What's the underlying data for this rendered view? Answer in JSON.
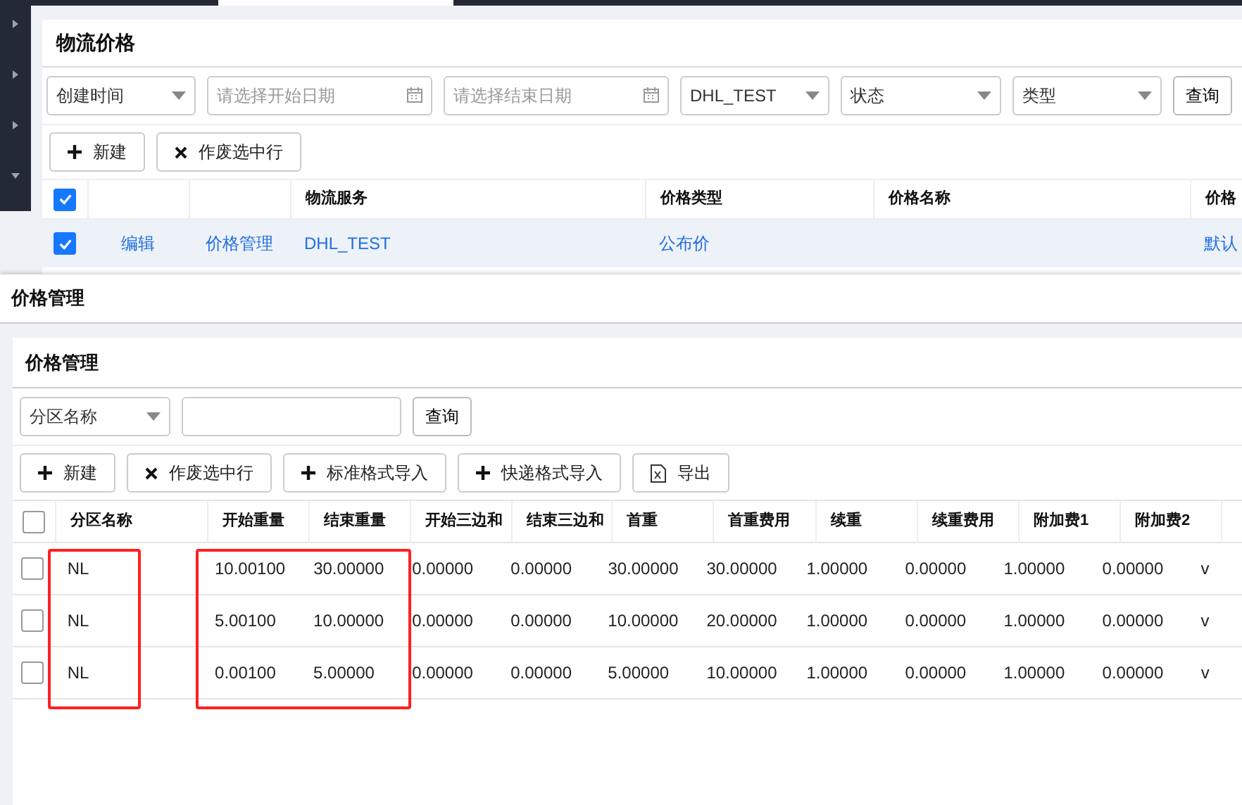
{
  "sidebar": {
    "items": [
      {
        "expanded": false
      },
      {
        "expanded": false
      },
      {
        "expanded": false
      },
      {
        "expanded": true
      }
    ]
  },
  "main": {
    "title": "物流价格",
    "filters": [
      {
        "kind": "select",
        "value": "创建时间"
      },
      {
        "kind": "date",
        "placeholder": "请选择开始日期"
      },
      {
        "kind": "date",
        "placeholder": "请选择结束日期"
      },
      {
        "kind": "select",
        "value": "DHL_TEST"
      },
      {
        "kind": "select",
        "value": "状态"
      },
      {
        "kind": "select",
        "value": "类型"
      }
    ],
    "search_button": "查询",
    "buttons": [
      {
        "kind": "plus",
        "label": "新建"
      },
      {
        "kind": "x",
        "label": "作废选中行"
      }
    ],
    "table": {
      "header_checked": true,
      "columns": [
        "物流服务",
        "价格类型",
        "价格名称",
        "价格"
      ],
      "rows": [
        {
          "checked": true,
          "edit_link": "编辑",
          "manage_link": "价格管理",
          "service": "DHL_TEST",
          "price_type": "公布价",
          "price_level": "默认"
        }
      ]
    }
  },
  "dialog": {
    "title": "价格管理",
    "panel": {
      "title": "价格管理",
      "select": "分区名称",
      "search_button": "查询",
      "buttons": [
        {
          "kind": "plus",
          "label": "新建"
        },
        {
          "kind": "x",
          "label": "作废选中行"
        },
        {
          "kind": "plus",
          "label": "标准格式导入"
        },
        {
          "kind": "plus",
          "label": "快递格式导入"
        },
        {
          "kind": "export",
          "label": "导出"
        }
      ],
      "table": {
        "header_checked": false,
        "columns": [
          "分区名称",
          "开始重量",
          "结束重量",
          "开始三边和",
          "结束三边和",
          "首重",
          "首重费用",
          "续重",
          "续重费用",
          "附加费1",
          "附加费2"
        ],
        "rows": [
          {
            "checked": false,
            "cells": [
              "NL",
              "10.00100",
              "30.00000",
              "0.00000",
              "0.00000",
              "30.00000",
              "30.00000",
              "1.00000",
              "0.00000",
              "1.00000",
              "0.00000",
              "v"
            ]
          },
          {
            "checked": false,
            "cells": [
              "NL",
              "5.00100",
              "10.00000",
              "0.00000",
              "0.00000",
              "10.00000",
              "20.00000",
              "1.00000",
              "0.00000",
              "1.00000",
              "0.00000",
              "v"
            ]
          },
          {
            "checked": false,
            "cells": [
              "NL",
              "0.00100",
              "5.00000",
              "0.00000",
              "0.00000",
              "5.00000",
              "10.00000",
              "1.00000",
              "0.00000",
              "1.00000",
              "0.00000",
              "v"
            ]
          }
        ]
      }
    }
  }
}
